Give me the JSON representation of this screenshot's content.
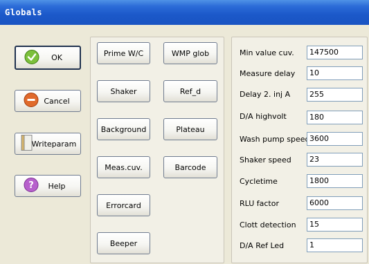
{
  "window": {
    "title": "Globals"
  },
  "left_buttons": {
    "ok": "OK",
    "cancel": "Cancel",
    "writeparam": "Writeparam",
    "help": "Help"
  },
  "mid_buttons": {
    "prime_wc": "Prime W/C",
    "wmp_glob": "WMP glob",
    "shaker": "Shaker",
    "ref_d": "Ref_d",
    "background": "Background",
    "plateau": "Plateau",
    "meas_cuv": "Meas.cuv.",
    "barcode": "Barcode",
    "errorcard": "Errorcard",
    "beeper": "Beeper"
  },
  "params": [
    {
      "label": "Min value cuv.",
      "value": "147500"
    },
    {
      "label": "Measure delay",
      "value": "10"
    },
    {
      "label": "Delay 2. inj A",
      "value": "255"
    },
    {
      "label": "D/A highvolt",
      "value": "180"
    },
    {
      "label": "Wash pump speed",
      "value": "3600"
    },
    {
      "label": "Shaker speed",
      "value": "23"
    },
    {
      "label": "Cycletime",
      "value": "1800"
    },
    {
      "label": "RLU factor",
      "value": "6000"
    },
    {
      "label": "Clott detection",
      "value": "15"
    },
    {
      "label": "D/A Ref Led",
      "value": "1"
    }
  ],
  "icons": {
    "ok": "check-icon",
    "cancel": "minus-icon",
    "writeparam": "notebook-icon",
    "help": "question-icon"
  }
}
